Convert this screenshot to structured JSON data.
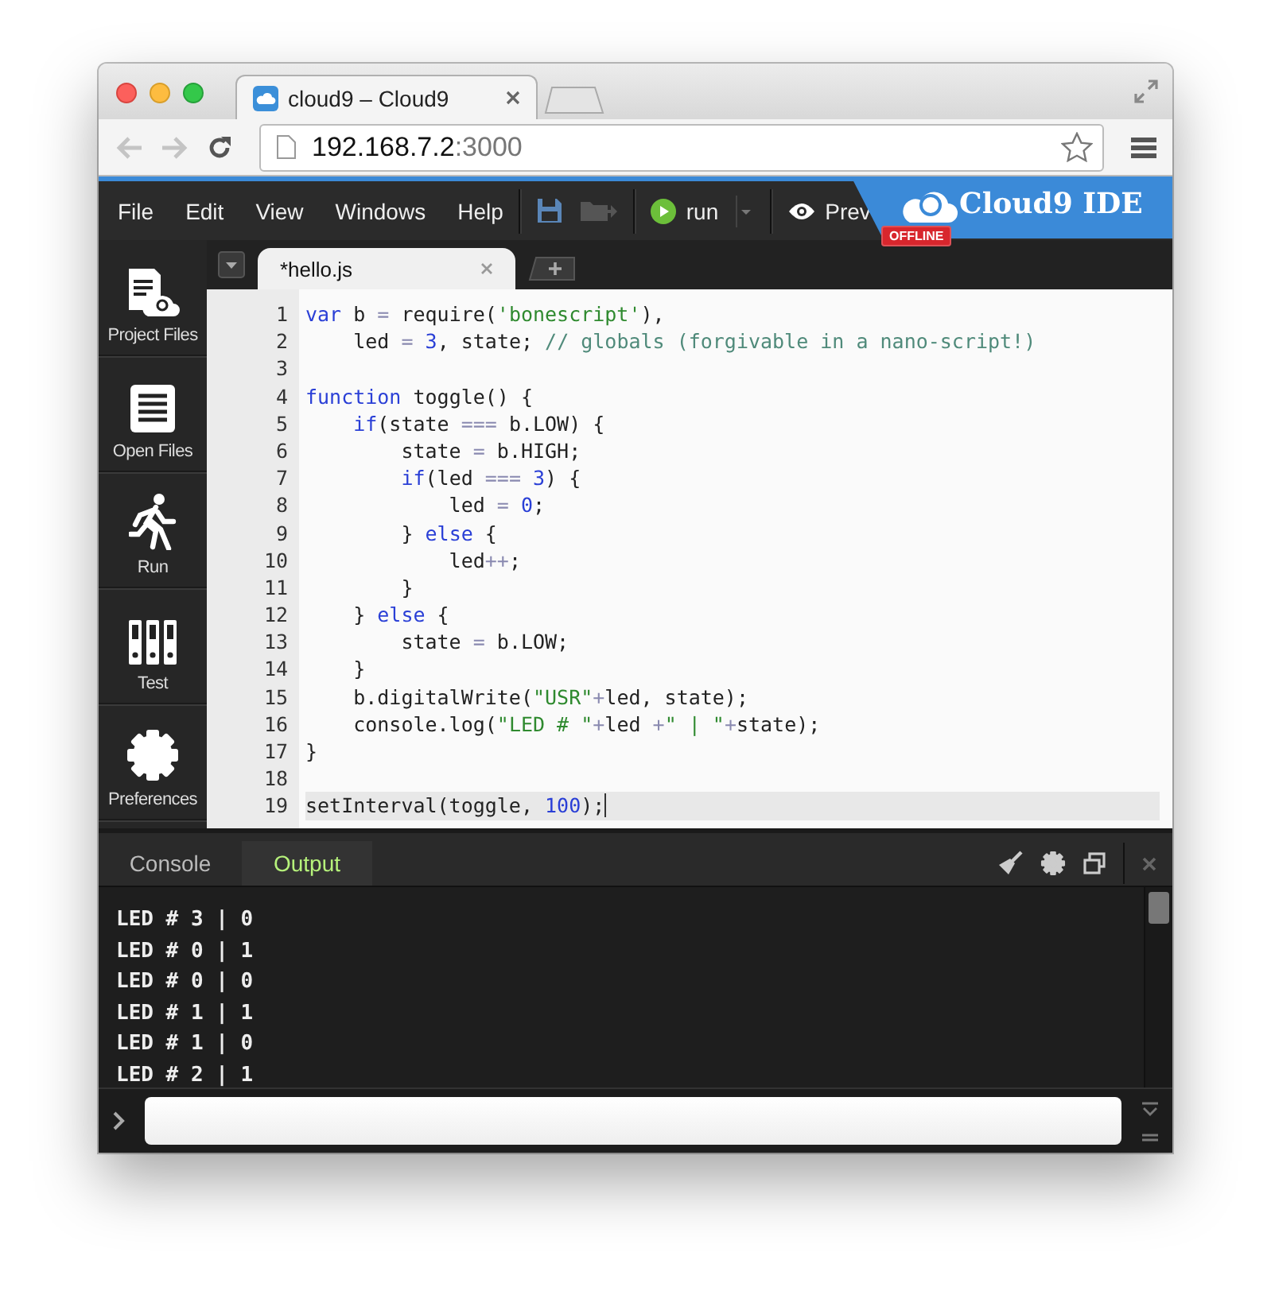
{
  "browser": {
    "tab_title": "cloud9 – Cloud9",
    "url_host": "192.168.7.2",
    "url_port": ":3000"
  },
  "ide": {
    "menu": [
      "File",
      "Edit",
      "View",
      "Windows",
      "Help"
    ],
    "run_label": "run",
    "preview_label": "Prev",
    "logo": "Cloud9 IDE",
    "badge": "OFFLINE"
  },
  "sidebar": {
    "items": [
      {
        "kind": "files",
        "label": "Project Files"
      },
      {
        "kind": "open",
        "label": "Open Files"
      },
      {
        "kind": "run",
        "label": "Run"
      },
      {
        "kind": "test",
        "label": "Test"
      },
      {
        "kind": "prefs",
        "label": "Preferences"
      }
    ]
  },
  "editor": {
    "tabs": [
      {
        "label": "*hello.js",
        "selected": true
      }
    ],
    "lines": [
      {
        "number": "1",
        "current": false,
        "tokens": [
          {
            "kind": "keyword",
            "text": "var"
          },
          {
            "kind": "plain",
            "text": " b "
          },
          {
            "kind": "operator",
            "text": "="
          },
          {
            "kind": "plain",
            "text": " require("
          },
          {
            "kind": "string",
            "text": "'bonescript'"
          },
          {
            "kind": "plain",
            "text": "),"
          }
        ]
      },
      {
        "number": "2",
        "current": false,
        "tokens": [
          {
            "kind": "plain",
            "text": "    led "
          },
          {
            "kind": "operator",
            "text": "= "
          },
          {
            "kind": "number",
            "text": "3"
          },
          {
            "kind": "plain",
            "text": ", state; "
          },
          {
            "kind": "comment",
            "text": "// globals (forgivable in a nano-script!)"
          }
        ]
      },
      {
        "number": "3",
        "current": false
      },
      {
        "number": "4",
        "current": false,
        "tokens": [
          {
            "kind": "keyword",
            "text": "function"
          },
          {
            "kind": "plain",
            "text": " toggle() {"
          }
        ]
      },
      {
        "number": "5",
        "current": false,
        "tokens": [
          {
            "kind": "keyword",
            "text": "    if"
          },
          {
            "kind": "plain",
            "text": "(state "
          },
          {
            "kind": "operator",
            "text": "==="
          },
          {
            "kind": "plain",
            "text": " b.LOW) {"
          }
        ]
      },
      {
        "number": "6",
        "current": false,
        "tokens": [
          {
            "kind": "plain",
            "text": "        state "
          },
          {
            "kind": "operator",
            "text": "="
          },
          {
            "kind": "plain",
            "text": " b.HIGH;"
          }
        ]
      },
      {
        "number": "7",
        "current": false,
        "tokens": [
          {
            "kind": "keyword",
            "text": "        if"
          },
          {
            "kind": "plain",
            "text": "(led "
          },
          {
            "kind": "operator",
            "text": "=== "
          },
          {
            "kind": "number",
            "text": "3"
          },
          {
            "kind": "plain",
            "text": ") {"
          }
        ]
      },
      {
        "number": "8",
        "current": false,
        "tokens": [
          {
            "kind": "plain",
            "text": "            led "
          },
          {
            "kind": "operator",
            "text": "= "
          },
          {
            "kind": "number",
            "text": "0"
          },
          {
            "kind": "plain",
            "text": ";"
          }
        ]
      },
      {
        "number": "9",
        "current": false,
        "tokens": [
          {
            "kind": "plain",
            "text": "        } "
          },
          {
            "kind": "keyword",
            "text": "else"
          },
          {
            "kind": "plain",
            "text": " {"
          }
        ]
      },
      {
        "number": "10",
        "current": false,
        "tokens": [
          {
            "kind": "plain",
            "text": "            led"
          },
          {
            "kind": "operator",
            "text": "++"
          },
          {
            "kind": "plain",
            "text": ";"
          }
        ]
      },
      {
        "number": "11",
        "current": false,
        "tokens": [
          {
            "kind": "plain",
            "text": "        }"
          }
        ]
      },
      {
        "number": "12",
        "current": false,
        "tokens": [
          {
            "kind": "plain",
            "text": "    } "
          },
          {
            "kind": "keyword",
            "text": "else"
          },
          {
            "kind": "plain",
            "text": " {"
          }
        ]
      },
      {
        "number": "13",
        "current": false,
        "tokens": [
          {
            "kind": "plain",
            "text": "        state "
          },
          {
            "kind": "operator",
            "text": "="
          },
          {
            "kind": "plain",
            "text": " b.LOW;"
          }
        ]
      },
      {
        "number": "14",
        "current": false,
        "tokens": [
          {
            "kind": "plain",
            "text": "    }"
          }
        ]
      },
      {
        "number": "15",
        "current": false,
        "tokens": [
          {
            "kind": "plain",
            "text": "    b.digitalWrite("
          },
          {
            "kind": "string",
            "text": "\"USR\""
          },
          {
            "kind": "operator",
            "text": "+"
          },
          {
            "kind": "plain",
            "text": "led, state);"
          }
        ]
      },
      {
        "number": "16",
        "current": false,
        "tokens": [
          {
            "kind": "plain",
            "text": "    console.log("
          },
          {
            "kind": "string",
            "text": "\"LED # \""
          },
          {
            "kind": "operator",
            "text": "+"
          },
          {
            "kind": "plain",
            "text": "led "
          },
          {
            "kind": "operator",
            "text": "+"
          },
          {
            "kind": "string",
            "text": "\" | \""
          },
          {
            "kind": "operator",
            "text": "+"
          },
          {
            "kind": "plain",
            "text": "state);"
          }
        ]
      },
      {
        "number": "17",
        "current": false,
        "tokens": [
          {
            "kind": "plain",
            "text": "}"
          }
        ]
      },
      {
        "number": "18",
        "current": false
      },
      {
        "number": "19",
        "current": true,
        "tokens": [
          {
            "kind": "plain",
            "text": "setInterval(toggle, "
          },
          {
            "kind": "number",
            "text": "100"
          },
          {
            "kind": "plain",
            "text": ");"
          }
        ]
      }
    ]
  },
  "console": {
    "tabs": [
      {
        "label": "Console",
        "selected": false
      },
      {
        "label": "Output",
        "selected": true
      }
    ],
    "output": [
      "LED # 3 | 0",
      "LED # 0 | 1",
      "LED # 0 | 0",
      "LED # 1 | 1",
      "LED # 1 | 0",
      "LED # 2 | 1"
    ]
  }
}
